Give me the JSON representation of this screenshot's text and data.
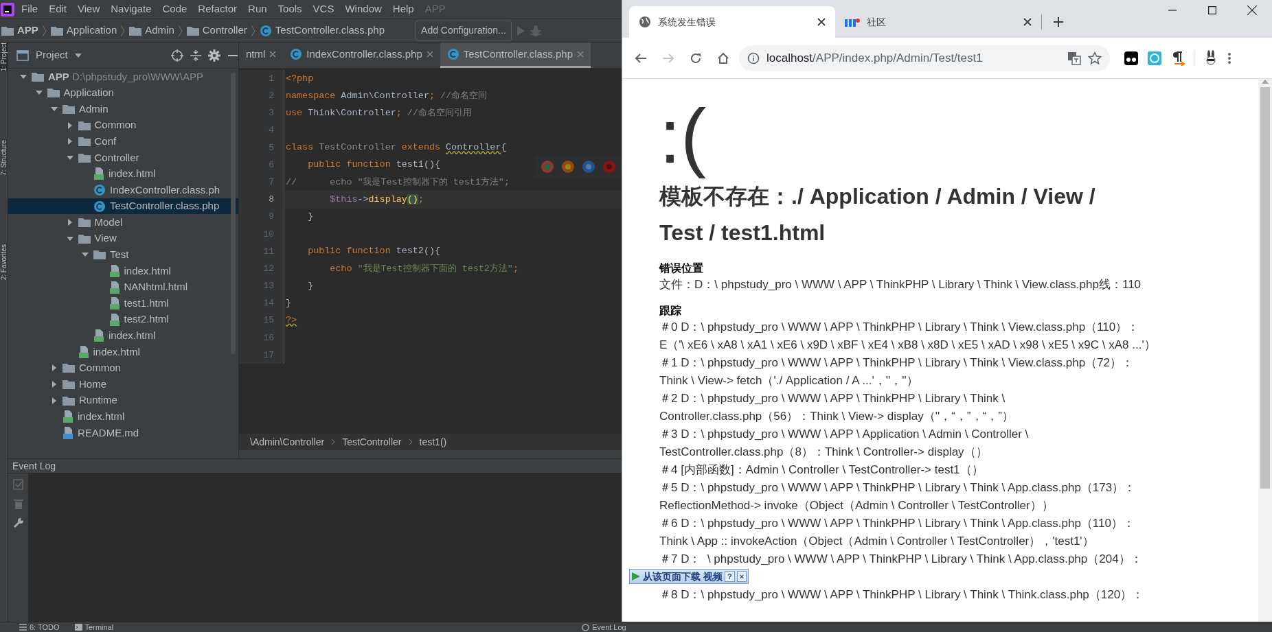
{
  "ide": {
    "menu": [
      "File",
      "Edit",
      "View",
      "Navigate",
      "Code",
      "Refactor",
      "Run",
      "Tools",
      "VCS",
      "Window",
      "Help"
    ],
    "project_name": "APP",
    "nav_path": [
      {
        "label": "APP",
        "kind": "root"
      },
      {
        "label": "Application",
        "kind": "folder"
      },
      {
        "label": "Admin",
        "kind": "folder"
      },
      {
        "label": "Controller",
        "kind": "folder"
      },
      {
        "label": "TestController.class.php",
        "kind": "php"
      }
    ],
    "run_config": "Add Configuration...",
    "side_labels": [
      "1: Project",
      "7: Structure",
      "2: Favorites"
    ],
    "project": {
      "title": "Project",
      "tree": [
        {
          "label": "APP",
          "path": "D:\\phpstudy_pro\\WWW\\APP",
          "kind": "folder",
          "expanded": true,
          "selected": false,
          "children": [
            {
              "label": "Application",
              "kind": "folder",
              "expanded": true,
              "selected": false,
              "children": [
                {
                  "label": "Admin",
                  "kind": "folder",
                  "expanded": true,
                  "selected": false,
                  "children": [
                    {
                      "label": "Common",
                      "kind": "folder",
                      "expanded": false,
                      "selected": false
                    },
                    {
                      "label": "Conf",
                      "kind": "folder",
                      "expanded": false,
                      "selected": false
                    },
                    {
                      "label": "Controller",
                      "kind": "folder",
                      "expanded": true,
                      "selected": false,
                      "children": [
                        {
                          "label": "index.html",
                          "kind": "html",
                          "selected": false
                        },
                        {
                          "label": "IndexController.class.ph",
                          "kind": "php",
                          "selected": false
                        },
                        {
                          "label": "TestController.class.php",
                          "kind": "php",
                          "selected": true
                        }
                      ]
                    },
                    {
                      "label": "Model",
                      "kind": "folder",
                      "expanded": false,
                      "selected": false
                    },
                    {
                      "label": "View",
                      "kind": "folder",
                      "expanded": true,
                      "selected": false,
                      "children": [
                        {
                          "label": "Test",
                          "kind": "folder",
                          "expanded": true,
                          "selected": false,
                          "children": [
                            {
                              "label": "index.html",
                              "kind": "html",
                              "selected": false
                            },
                            {
                              "label": "NANhtml.html",
                              "kind": "html",
                              "selected": false
                            },
                            {
                              "label": "test1.html",
                              "kind": "html",
                              "selected": false
                            },
                            {
                              "label": "test2.html",
                              "kind": "html",
                              "selected": false
                            }
                          ]
                        },
                        {
                          "label": "index.html",
                          "kind": "html",
                          "selected": false
                        }
                      ]
                    },
                    {
                      "label": "index.html",
                      "kind": "html",
                      "selected": false
                    }
                  ]
                },
                {
                  "label": "Common",
                  "kind": "folder",
                  "expanded": false,
                  "selected": false
                },
                {
                  "label": "Home",
                  "kind": "folder",
                  "expanded": false,
                  "selected": false
                },
                {
                  "label": "Runtime",
                  "kind": "folder",
                  "expanded": false,
                  "selected": false
                },
                {
                  "label": "index.html",
                  "kind": "html",
                  "selected": false
                },
                {
                  "label": "README.md",
                  "kind": "md",
                  "selected": false
                }
              ]
            }
          ]
        }
      ]
    },
    "editor_tabs": [
      {
        "label": "ntml",
        "kind": "cut",
        "selected": false
      },
      {
        "label": "IndexController.class.php",
        "kind": "php",
        "selected": false
      },
      {
        "label": "TestController.class.php",
        "kind": "php",
        "selected": true
      }
    ],
    "code_lines": [
      {
        "number": "1",
        "current": false,
        "tokens": [
          {
            "text": "<?php",
            "kind": "keyword"
          }
        ]
      },
      {
        "number": "2",
        "current": false,
        "tokens": [
          {
            "text": "namespace",
            "kind": "keyword"
          },
          {
            "text": " Admin\\Controller",
            "kind": "plain"
          },
          {
            "text": ";",
            "kind": "keyword"
          },
          {
            "text": " //命名空间",
            "kind": "comment"
          }
        ]
      },
      {
        "number": "3",
        "current": false,
        "tokens": [
          {
            "text": "use",
            "kind": "keyword"
          },
          {
            "text": " Think\\Controller",
            "kind": "plain"
          },
          {
            "text": ";",
            "kind": "keyword"
          },
          {
            "text": " //命名空间引用",
            "kind": "comment"
          }
        ]
      },
      {
        "number": "4",
        "current": false
      },
      {
        "number": "5",
        "current": false,
        "tokens": [
          {
            "text": "class",
            "kind": "keyword"
          },
          {
            "text": " TestController ",
            "kind": "unused"
          },
          {
            "text": "extends ",
            "kind": "keyword"
          },
          {
            "text": "Controller",
            "kind": "warning"
          },
          {
            "text": "{",
            "kind": "plain"
          }
        ]
      },
      {
        "number": "6",
        "current": false,
        "tokens": [
          {
            "text": "    public function",
            "kind": "keyword"
          },
          {
            "text": " test1(){",
            "kind": "plain"
          }
        ]
      },
      {
        "number": "7",
        "current": false,
        "tokens": [
          {
            "text": "//      echo \"我是Test控制器下的 test1方法\";",
            "kind": "comment"
          }
        ]
      },
      {
        "number": "8",
        "current": true,
        "tokens": [
          {
            "text": "        $this",
            "kind": "variable"
          },
          {
            "text": "->",
            "kind": "plain"
          },
          {
            "text": "display",
            "kind": "function"
          },
          {
            "text": "()",
            "kind": "match"
          },
          {
            "text": ";",
            "kind": "keyword"
          }
        ]
      },
      {
        "number": "9",
        "current": false,
        "tokens": [
          {
            "text": "    }",
            "kind": "plain"
          }
        ]
      },
      {
        "number": "10",
        "current": false
      },
      {
        "number": "11",
        "current": false,
        "tokens": [
          {
            "text": "    public function",
            "kind": "keyword"
          },
          {
            "text": " test2(){",
            "kind": "plain"
          }
        ]
      },
      {
        "number": "12",
        "current": false,
        "tokens": [
          {
            "text": "        echo",
            "kind": "keyword"
          },
          {
            "text": " \"我是Test控制器下面的 test2方法\"",
            "kind": "string"
          },
          {
            "text": ";",
            "kind": "keyword"
          }
        ]
      },
      {
        "number": "13",
        "current": false,
        "tokens": [
          {
            "text": "    }",
            "kind": "plain"
          }
        ]
      },
      {
        "number": "14",
        "current": false,
        "tokens": [
          {
            "text": "}",
            "kind": "plain"
          }
        ]
      },
      {
        "number": "15",
        "current": false,
        "tokens": [
          {
            "text": "?>",
            "kind": "keyword-warning"
          }
        ]
      },
      {
        "number": "16",
        "current": false
      },
      {
        "number": "17",
        "current": false
      }
    ],
    "code_breadcrumb": [
      "\\Admin\\Controller",
      "TestController",
      "test1()"
    ],
    "event_log": {
      "title": "Event Log"
    },
    "status_bar": [
      {
        "label": "6: TODO",
        "kind": "todo"
      },
      {
        "label": "Terminal",
        "kind": "terminal"
      },
      {
        "label": "Event Log",
        "kind": "log"
      }
    ]
  },
  "browser": {
    "tabs": [
      {
        "title": "系统发生错误",
        "kind": "globe",
        "selected": true
      },
      {
        "title": "社区",
        "kind": "site",
        "selected": false
      }
    ],
    "nav_buttons": [
      {
        "kind": "back",
        "disabled": false
      },
      {
        "kind": "forward",
        "disabled": true
      },
      {
        "kind": "reload",
        "disabled": false
      },
      {
        "kind": "home",
        "disabled": false
      }
    ],
    "url": {
      "host": "localhost",
      "path": "/APP/index.php/Admin/Test/test1"
    },
    "page": {
      "face": ":(",
      "heading": "模板不存在：./ Application / Admin / View / Test / test1.html",
      "location_title": "错误位置",
      "location": "文件：D：\\ phpstudy_pro \\ WWW \\ APP \\ ThinkPHP \\ Library \\ Think \\ View.class.php线：110",
      "trace_title": "跟踪",
      "trace": [
        "＃0 D：\\ phpstudy_pro \\ WWW \\ APP \\ ThinkPHP \\ Library \\ Think \\ View.class.php（110）：\nE（'\\ xE6 \\ xA8 \\ xA1 \\ xE6 \\ x9D \\ xBF \\ xE4 \\ xB8 \\ x8D \\ xE5 \\ xAD \\ x98 \\ xE5 \\ x9C \\ xA8 ...'）",
        "＃1 D：\\ phpstudy_pro \\ WWW \\ APP \\ ThinkPHP \\ Library \\ Think \\ View.class.php（72）：\nThink \\ View-> fetch（'./ Application / A ...'，''，''）",
        "＃2 D：\\ phpstudy_pro \\ WWW \\ APP \\ ThinkPHP \\ Library \\ Think \\\nController.class.php（56）：Think \\ View-> display（''，“，”，“，”）",
        "＃3 D：\\ phpstudy_pro \\ WWW \\ APP \\ Application \\ Admin \\ Controller \\\nTestController.class.php（8）：Think \\ Controller-> display（）",
        "＃4 [内部函数]：Admin \\ Controller \\ TestController-> test1（）",
        "＃5 D：\\ phpstudy_pro \\ WWW \\ APP \\ ThinkPHP \\ Library \\ Think \\ App.class.php（173）：\nReflectionMethod-> invoke（Object（Admin \\ Controller \\ TestController））",
        "＃6 D：\\ phpstudy_pro \\ WWW \\ APP \\ ThinkPHP \\ Library \\ Think \\ App.class.php（110）：\nThink \\ App :: invokeAction（Object（Admin \\ Controller \\ TestController），'test1'）",
        "＃7 D：  \\ phpstudy_pro \\ WWW \\ APP \\ ThinkPHP \\ Library \\ Think \\ App.class.php（204）：",
        "＃8 D：\\ phpstudy_pro \\ WWW \\ APP \\ ThinkPHP \\ Library \\ Think \\ Think.class.php（120）："
      ]
    },
    "download_bar": {
      "label": "从该页面下载 视频",
      "help": "?",
      "close": "×"
    }
  }
}
